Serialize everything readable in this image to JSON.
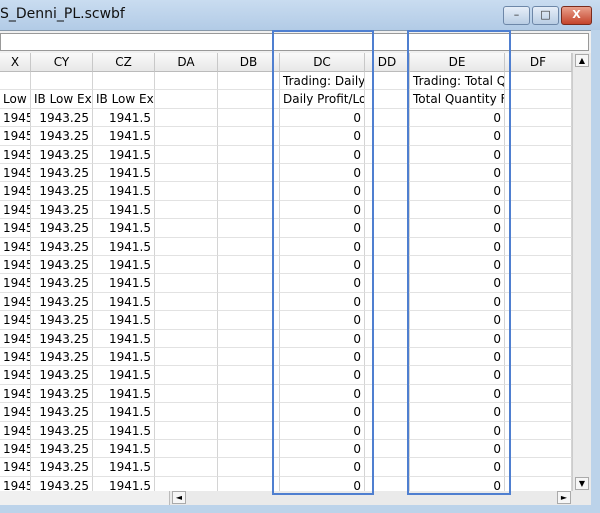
{
  "window": {
    "title": "S_Denni_PL.scwbf",
    "minimize": "–",
    "maximize": "□",
    "close": "X"
  },
  "columns": [
    {
      "id": "X",
      "row1": "",
      "row2": "Low Ext",
      "align": "r"
    },
    {
      "id": "CY",
      "row1": "",
      "row2": "IB Low Ext"
    },
    {
      "id": "CZ",
      "row1": "",
      "row2": "IB Low Ext"
    },
    {
      "id": "DA",
      "row1": "",
      "row2": ""
    },
    {
      "id": "DB",
      "row1": "",
      "row2": ""
    },
    {
      "id": "DC",
      "row1": "Trading: Daily",
      "row2": "Daily Profit/Lo"
    },
    {
      "id": "DD",
      "row1": "",
      "row2": ""
    },
    {
      "id": "DE",
      "row1": "Trading: Total Qu",
      "row2": "Total Quantity Fil"
    },
    {
      "id": "DF",
      "row1": "",
      "row2": ""
    }
  ],
  "data_row": [
    "1945",
    "1943.25",
    "1941.5",
    "",
    "",
    "0",
    "",
    "0",
    ""
  ],
  "data_row_count": 21,
  "highlighted_columns": [
    "DC",
    "DE"
  ],
  "scroll": {
    "up": "▲",
    "down": "▼",
    "left": "◄",
    "right": "►"
  }
}
